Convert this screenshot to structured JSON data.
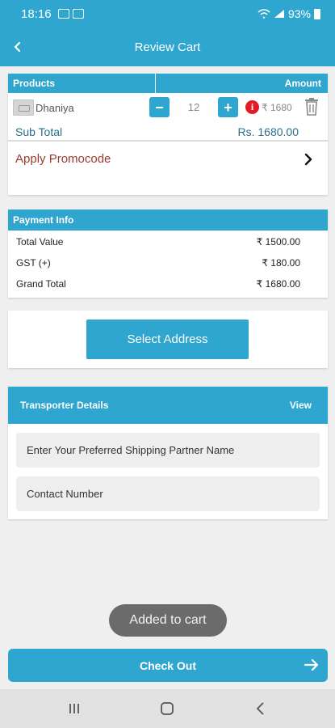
{
  "status_bar": {
    "time": "18:16",
    "battery": "93%"
  },
  "header": {
    "title": "Review Cart"
  },
  "products": {
    "col_products": "Products",
    "col_amount": "Amount",
    "item": {
      "name": "Dhaniya",
      "quantity": "12",
      "amount": "₹ 1680"
    },
    "subtotal_label": "Sub Total",
    "subtotal_value": "Rs. 1680.00",
    "promo_label": "Apply Promocode"
  },
  "payment": {
    "title": "Payment Info",
    "rows": [
      {
        "label": "Total Value",
        "value": "₹ 1500.00"
      },
      {
        "label": "GST (+)",
        "value": "₹ 180.00"
      },
      {
        "label": "Grand Total",
        "value": "₹ 1680.00"
      }
    ]
  },
  "address": {
    "button_label": "Select Address"
  },
  "transporter": {
    "title": "Transporter Details",
    "view_label": "View",
    "partner_placeholder": "Enter Your Preferred Shipping Partner Name",
    "contact_placeholder": "Contact Number"
  },
  "toast": "Added to cart",
  "checkout_label": "Check Out",
  "colors": {
    "primary": "#2fa6cf",
    "promo_text": "#9c3b30",
    "info_red": "#e31b23"
  },
  "icons": [
    "back-arrow-icon",
    "info-icon",
    "trash-icon",
    "chevron-right-icon",
    "arrow-right-icon",
    "recents-icon",
    "home-icon",
    "nav-back-icon"
  ]
}
